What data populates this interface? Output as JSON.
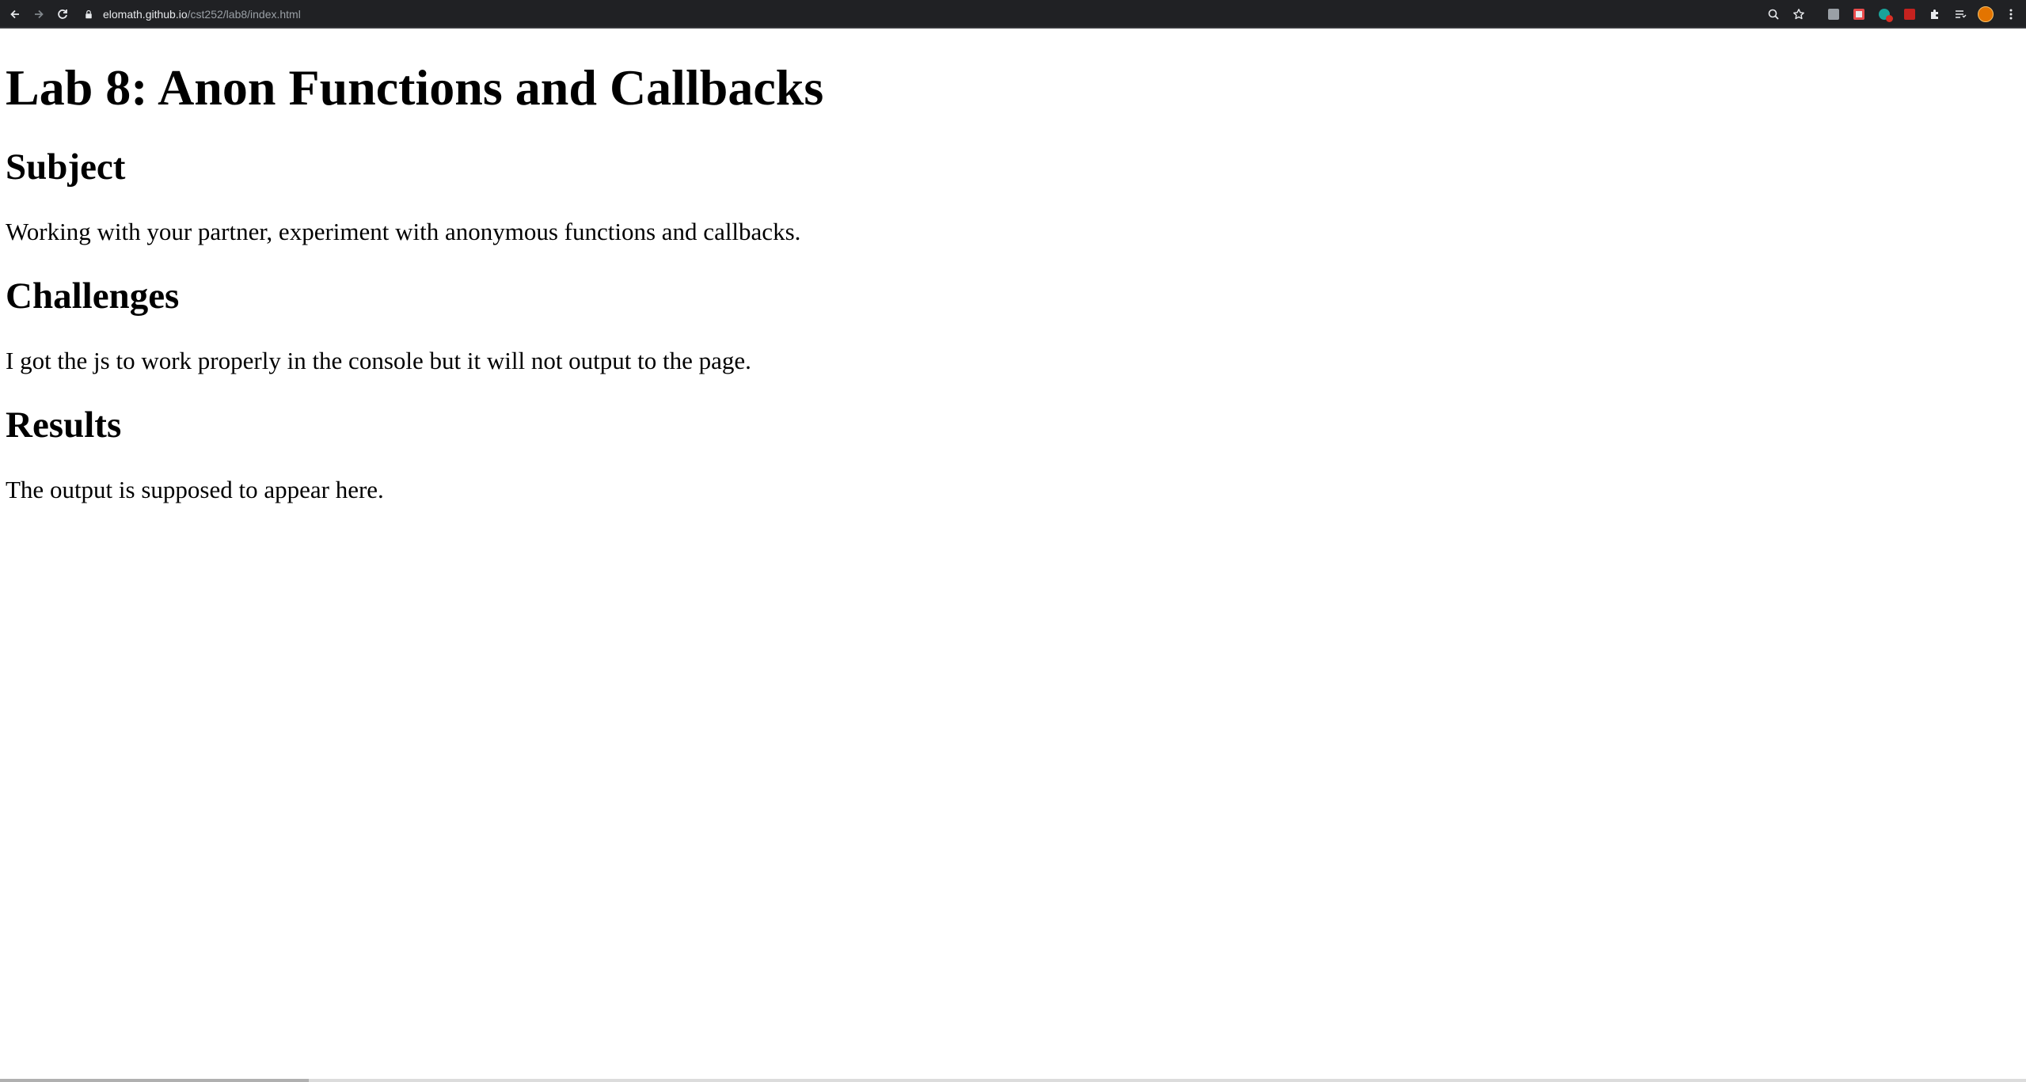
{
  "browser": {
    "url_host": "elomath.github.io",
    "url_path": "/cst252/lab8/index.html",
    "back_icon": "arrow-left-icon",
    "forward_icon": "arrow-right-icon",
    "reload_icon": "reload-icon",
    "lock_icon": "lock-icon",
    "zoom_icon": "zoom-icon",
    "star_icon": "star-icon",
    "extensions_icon": "puzzle-icon",
    "reading_list_icon": "reading-list-icon",
    "menu_icon": "kebab-menu-icon",
    "toolbar_color": "#202124"
  },
  "page": {
    "title": "Lab 8: Anon Functions and Callbacks",
    "sections": [
      {
        "heading": "Subject",
        "text": "Working with your partner, experiment with anonymous functions and callbacks."
      },
      {
        "heading": "Challenges",
        "text": "I got the js to work properly in the console but it will not output to the page."
      },
      {
        "heading": "Results",
        "text": "The output is supposed to appear here."
      }
    ]
  }
}
